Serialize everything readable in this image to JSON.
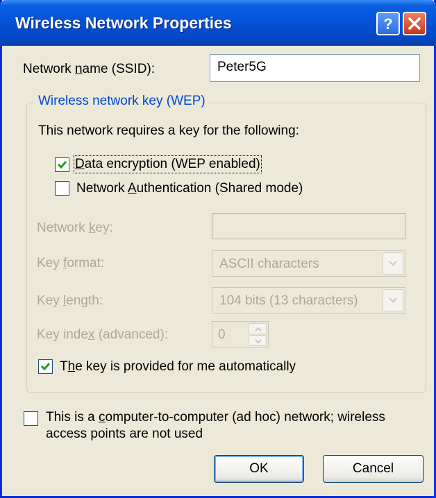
{
  "window": {
    "title": "Wireless Network Properties",
    "help_icon": "question-mark-icon",
    "close_icon": "close-x-icon"
  },
  "ssid": {
    "label_pre": "Network ",
    "label_accel": "n",
    "label_post": "ame (SSID):",
    "value": "Peter5G"
  },
  "wep_group": {
    "legend": "Wireless network key (WEP)",
    "requires_text": "This network requires a key for the following:",
    "data_encryption": {
      "checked": true,
      "label_accel": "D",
      "label_post": "ata encryption (WEP enabled)"
    },
    "network_auth": {
      "checked": false,
      "label_pre": "Network ",
      "label_accel": "A",
      "label_post": "uthentication (Shared mode)"
    },
    "network_key": {
      "label_pre": "Network ",
      "label_accel": "k",
      "label_post": "ey:",
      "value": ""
    },
    "key_format": {
      "label_pre": "Key ",
      "label_accel": "f",
      "label_post": "ormat:",
      "value": "ASCII characters"
    },
    "key_length": {
      "label_pre": "Key ",
      "label_accel": "l",
      "label_post": "ength:",
      "value": "104 bits (13 characters)"
    },
    "key_index": {
      "label_pre": "Key inde",
      "label_accel": "x",
      "label_post": " (advanced):",
      "value": "0"
    },
    "auto_key": {
      "checked": true,
      "label_pre": "T",
      "label_accel": "h",
      "label_post": "e key is provided for me automatically"
    }
  },
  "adhoc": {
    "checked": false,
    "line1_pre": "This is a ",
    "line1_accel": "c",
    "line1_post": "omputer-to-computer (ad hoc) network; wireless",
    "line2": "access points are not used"
  },
  "buttons": {
    "ok": "OK",
    "cancel": "Cancel"
  },
  "colors": {
    "titlebar": "#0553d8",
    "dialog_bg": "#ece9d8",
    "group_legend": "#0046d5",
    "disabled_text": "#aca899",
    "checkmark": "#21a121"
  }
}
